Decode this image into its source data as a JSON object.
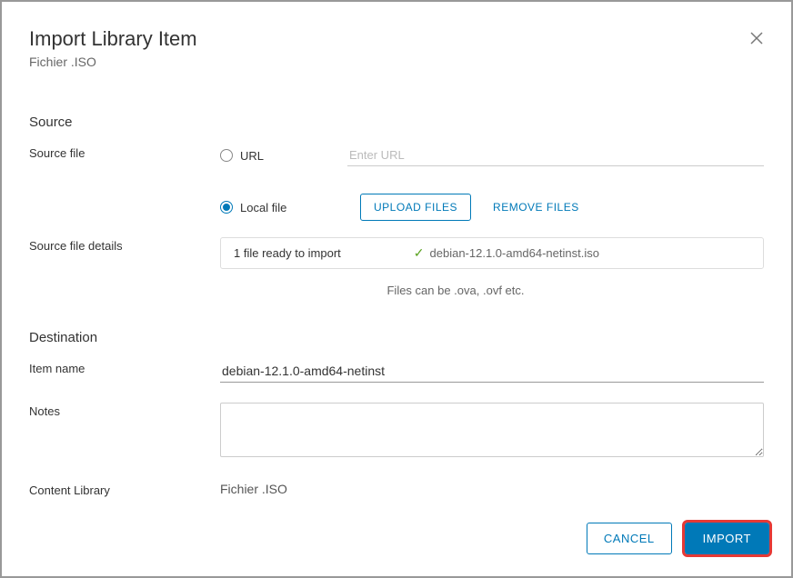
{
  "header": {
    "title": "Import Library Item",
    "subtitle": "Fichier .ISO"
  },
  "source": {
    "section_title": "Source",
    "source_file_label": "Source file",
    "url_option": "URL",
    "url_placeholder": "Enter URL",
    "local_file_option": "Local file",
    "upload_files_btn": "Upload Files",
    "remove_files_btn": "Remove Files",
    "source_file_details_label": "Source file details",
    "file_ready_text": "1 file ready to import",
    "file_name": "debian-12.1.0-amd64-netinst.iso",
    "hint": "Files can be .ova, .ovf etc."
  },
  "destination": {
    "section_title": "Destination",
    "item_name_label": "Item name",
    "item_name_value": "debian-12.1.0-amd64-netinst",
    "notes_label": "Notes",
    "notes_value": "",
    "content_library_label": "Content Library",
    "content_library_value": "Fichier .ISO"
  },
  "footer": {
    "cancel": "Cancel",
    "import": "Import"
  }
}
